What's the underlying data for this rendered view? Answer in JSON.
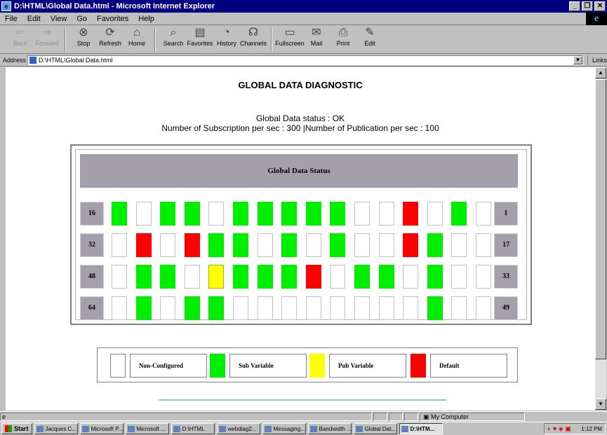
{
  "window": {
    "title": "D:\\HTML\\Global Data.html - Microsoft Internet Explorer"
  },
  "menu": [
    "File",
    "Edit",
    "View",
    "Go",
    "Favorites",
    "Help"
  ],
  "toolbar": [
    {
      "label": "Back",
      "icon": "back-arrow-icon",
      "glyph": "⇐",
      "disabled": true
    },
    {
      "label": "Forward",
      "icon": "forward-arrow-icon",
      "glyph": "⇒",
      "disabled": true
    },
    {
      "label": "Stop",
      "icon": "stop-icon",
      "glyph": "⊗",
      "disabled": false
    },
    {
      "label": "Refresh",
      "icon": "refresh-icon",
      "glyph": "⟳",
      "disabled": false
    },
    {
      "label": "Home",
      "icon": "home-icon",
      "glyph": "⌂",
      "disabled": false
    },
    {
      "label": "Search",
      "icon": "search-icon",
      "glyph": "⌕",
      "disabled": false
    },
    {
      "label": "Favorites",
      "icon": "favorites-icon",
      "glyph": "▤",
      "disabled": false
    },
    {
      "label": "History",
      "icon": "history-icon",
      "glyph": "◔",
      "disabled": false
    },
    {
      "label": "Channels",
      "icon": "channels-icon",
      "glyph": "☊",
      "disabled": false
    },
    {
      "label": "Fullscreen",
      "icon": "fullscreen-icon",
      "glyph": "▭",
      "disabled": false
    },
    {
      "label": "Mail",
      "icon": "mail-icon",
      "glyph": "✉",
      "disabled": false
    },
    {
      "label": "Print",
      "icon": "print-icon",
      "glyph": "⎙",
      "disabled": false
    },
    {
      "label": "Edit",
      "icon": "edit-icon",
      "glyph": "✎",
      "disabled": false
    }
  ],
  "address": {
    "label": "Address",
    "value": "D:\\HTML\\Global Data.html",
    "links_label": "Links"
  },
  "page": {
    "title": "GLOBAL DATA DIAGNOSTIC",
    "status_line": "Global Data status : OK",
    "rate_line": "Number of Subscription per sec : 300 |Number of Publication per sec : 100",
    "panel_title": "Global Data Status"
  },
  "grid": {
    "rows": [
      {
        "left": "16",
        "right": "1",
        "bits": [
          "S",
          "E",
          "S",
          "S",
          "E",
          "S",
          "S",
          "S",
          "S",
          "S",
          "E",
          "E",
          "D",
          "E",
          "S",
          "E"
        ]
      },
      {
        "left": "32",
        "right": "17",
        "bits": [
          "E",
          "D",
          "E",
          "D",
          "S",
          "S",
          "E",
          "S",
          "E",
          "S",
          "E",
          "E",
          "D",
          "S",
          "E",
          "E"
        ]
      },
      {
        "left": "48",
        "right": "33",
        "bits": [
          "E",
          "S",
          "S",
          "E",
          "P",
          "S",
          "S",
          "S",
          "D",
          "E",
          "S",
          "S",
          "E",
          "S",
          "E",
          "E"
        ]
      },
      {
        "left": "64",
        "right": "49",
        "bits": [
          "E",
          "S",
          "E",
          "S",
          "S",
          "E",
          "E",
          "E",
          "E",
          "E",
          "E",
          "E",
          "E",
          "S",
          "E",
          "E"
        ]
      }
    ],
    "colors": {
      "S": "#00ee00",
      "P": "#ffff00",
      "D": "#ff0000",
      "E": "#ffffff"
    }
  },
  "legend": [
    {
      "label": "Non-Configured",
      "color": "#ffffff"
    },
    {
      "label": "Sub Variable",
      "color": "#00ee00"
    },
    {
      "label": "Pub Variable",
      "color": "#ffff00"
    },
    {
      "label": "Default",
      "color": "#ff0000"
    }
  ],
  "statusbar": {
    "zone": "My Computer"
  },
  "taskbar": {
    "start": "Start",
    "tasks": [
      "Jacques C...",
      "Microsoft P...",
      "Microsoft ...",
      "D:\\HTML",
      "webdiag2...",
      "Messaging...",
      "Bandwidth ...",
      "Global Dat...",
      "D:\\HTM..."
    ],
    "active_index": 8,
    "clock": "1:12 PM"
  }
}
